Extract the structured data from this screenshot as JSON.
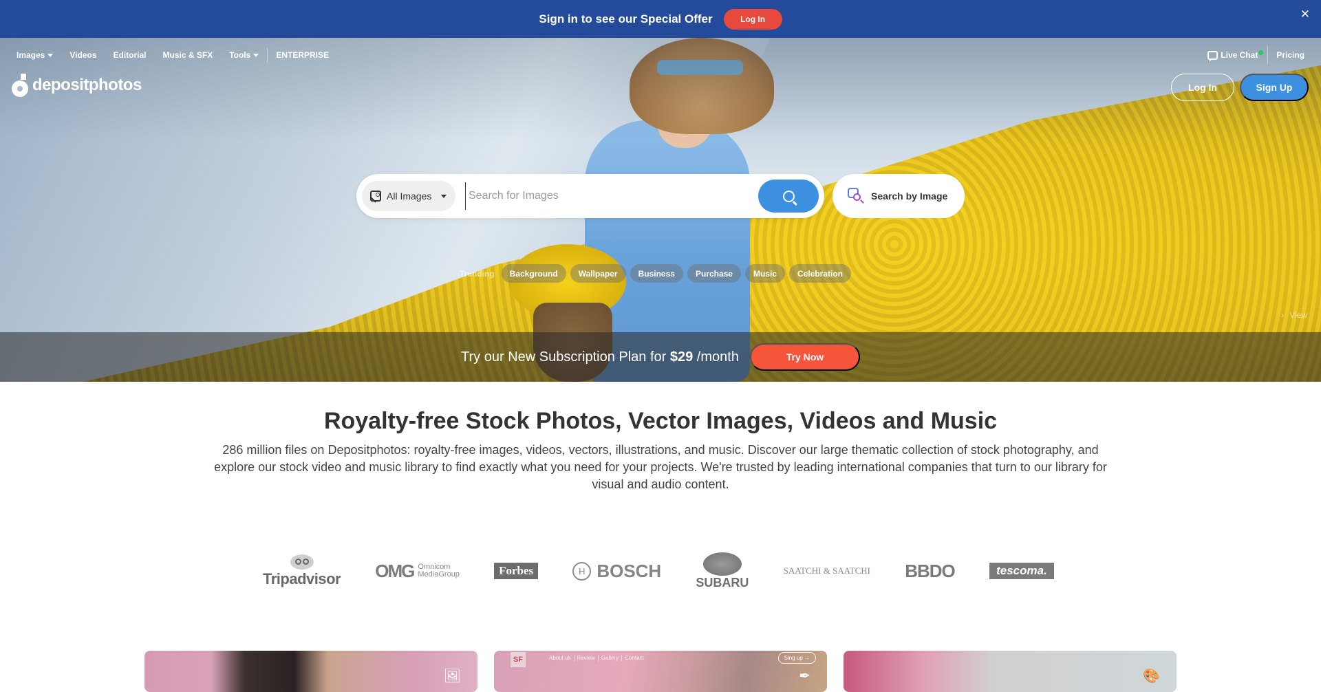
{
  "promo": {
    "text": "Sign in to see our Special Offer",
    "login_label": "Log In",
    "close_glyph": "✕",
    "bg_color": "#234a9b",
    "button_color": "#e8493d"
  },
  "nav": {
    "items": [
      {
        "label": "Images",
        "has_dropdown": true
      },
      {
        "label": "Videos",
        "has_dropdown": false
      },
      {
        "label": "Editorial",
        "has_dropdown": false
      },
      {
        "label": "Music & SFX",
        "has_dropdown": false
      },
      {
        "label": "Tools",
        "has_dropdown": true
      },
      {
        "label": "ENTERPRISE",
        "has_dropdown": false
      }
    ],
    "live_chat": "Live Chat",
    "live_chat_status": "online",
    "pricing": "Pricing"
  },
  "brand": {
    "logo_text": "depositphotos"
  },
  "auth": {
    "login_label": "Log In",
    "signup_label": "Sign Up",
    "signup_color": "#3d8fe0"
  },
  "search": {
    "type_selected": "All Images",
    "placeholder": "Search for Images",
    "value": "",
    "search_by_image_label": "Search by Image"
  },
  "trending": {
    "label": "Trending",
    "tags": [
      "Background",
      "Wallpaper",
      "Business",
      "Purchase",
      "Music",
      "Celebration"
    ]
  },
  "hero": {
    "view_label": "View"
  },
  "subscription": {
    "text_before": "Try our New Subscription Plan for ",
    "price": "$29",
    "text_after": " /month",
    "cta_label": "Try Now",
    "cta_color": "#f4553b"
  },
  "intro": {
    "title": "Royalty-free Stock Photos, Vector Images, Videos and Music",
    "description": "286 million files on Depositphotos: royalty-free images, videos, vectors, illustrations, and music. Discover our large thematic collection of stock photography, and explore our stock video and music library to find exactly what you need for your projects. We're trusted by leading international companies that turn to our library for visual and audio content."
  },
  "brands": {
    "tripadvisor": "Tripadvisor",
    "omg_big": "OMG",
    "omg_line1": "Omnicom",
    "omg_line2": "MediaGroup",
    "forbes": "Forbes",
    "bosch": "BOSCH",
    "subaru": "SUBARU",
    "saatchi": "SAATCHI & SAATCHI",
    "bbdo": "BBDO",
    "tescoma": "tescoma."
  },
  "cards": [
    {
      "kind": "photo",
      "icon": "image-icon"
    },
    {
      "kind": "vector",
      "icon": "pen-tool-icon",
      "preview_logo": "SF",
      "preview_nav": [
        "About us",
        "Review",
        "Gallery",
        "Contact"
      ],
      "preview_button": "Sing up →"
    },
    {
      "kind": "illustration",
      "icon": "palette-icon"
    }
  ]
}
